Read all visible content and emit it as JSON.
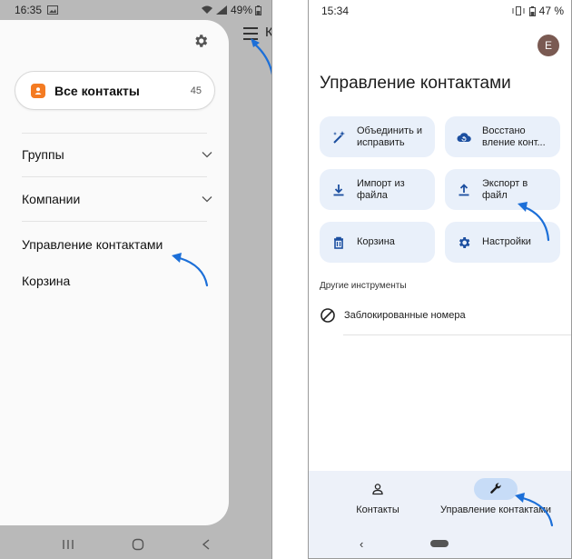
{
  "left_phone": {
    "status_bar": {
      "time": "16:35",
      "battery": "49%"
    },
    "drawer": {
      "all_contacts": {
        "label": "Все контакты",
        "count": "45"
      },
      "items": [
        {
          "label": "Группы",
          "expandable": true
        },
        {
          "label": "Компании",
          "expandable": true
        },
        {
          "label": "Управление контактами",
          "expandable": false
        },
        {
          "label": "Корзина",
          "expandable": false
        }
      ]
    },
    "behind_title_letter": "К",
    "icons": {
      "settings": "gear-icon",
      "menu": "hamburger-icon"
    }
  },
  "right_phone": {
    "status_bar": {
      "time": "15:34",
      "battery": "47 %"
    },
    "avatar_letter": "E",
    "title": "Управление контактами",
    "tiles": [
      {
        "label": "Объединить и\nисправить",
        "icon": "magic-wand-icon"
      },
      {
        "label": "Восстано\nвление конт...",
        "icon": "cloud-restore-icon"
      },
      {
        "label": "Импорт из\nфайла",
        "icon": "download-icon"
      },
      {
        "label": "Экспорт в\nфайл",
        "icon": "upload-icon"
      },
      {
        "label": "Корзина",
        "icon": "trash-icon"
      },
      {
        "label": "Настройки",
        "icon": "settings-icon"
      }
    ],
    "other_tools_heading": "Другие инструменты",
    "blocked_label": "Заблокированные номера",
    "bottom_nav": [
      {
        "label": "Контакты",
        "active": false
      },
      {
        "label": "Управление контактами",
        "active": true
      }
    ]
  },
  "colors": {
    "accent_blue": "#1c6fd8",
    "tile_bg": "#e9f0fa",
    "active_pill": "#c7dcf7",
    "contacts_orange": "#f47b22"
  }
}
